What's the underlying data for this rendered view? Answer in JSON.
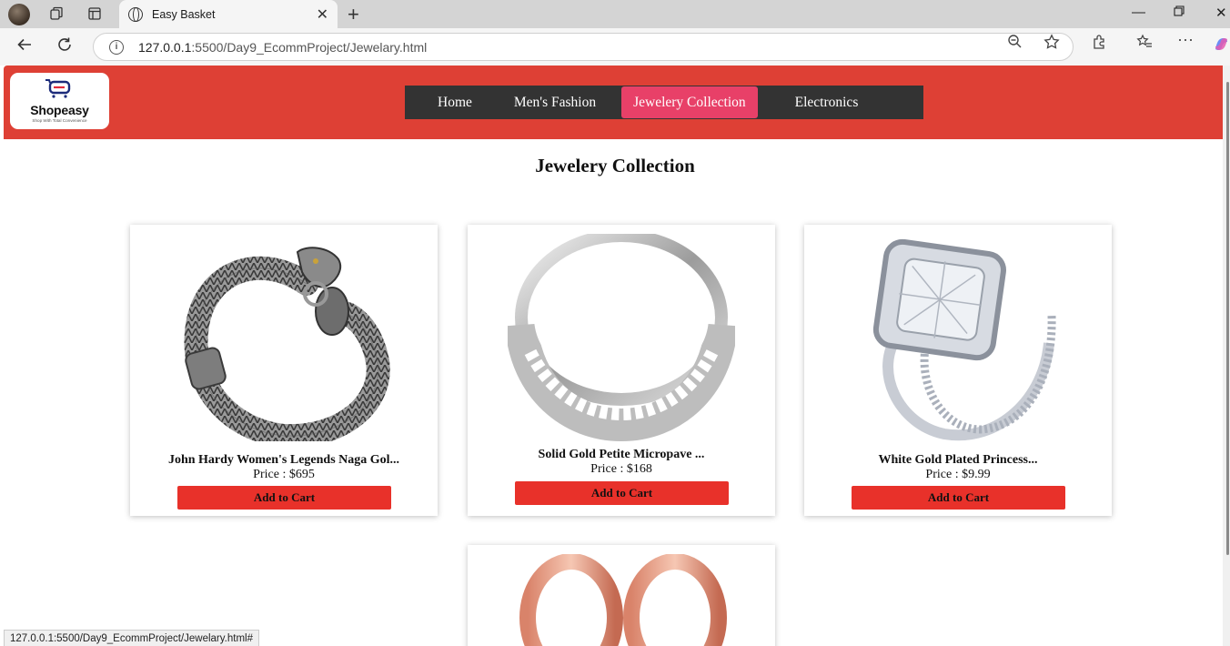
{
  "browser": {
    "tab_title": "Easy Basket",
    "url_host": "127.0.0.1",
    "url_path": ":5500/Day9_EcommProject/Jewelary.html",
    "status_url": "127.0.0.1:5500/Day9_EcommProject/Jewelary.html#"
  },
  "site": {
    "logo_name": "Shopeasy",
    "logo_tagline": "Shop With Total Convenience",
    "nav": [
      {
        "label": "Home",
        "active": false
      },
      {
        "label": "Men's Fashion",
        "active": false
      },
      {
        "label": "Jewelery Collection",
        "active": true
      },
      {
        "label": "Electronics",
        "active": false
      }
    ],
    "page_title": "Jewelery Collection"
  },
  "products": [
    {
      "name": "John Hardy Women's Legends Naga Gol...",
      "price": "Price : $695",
      "button": "Add to Cart",
      "icon": "dragon-bracelet-image"
    },
    {
      "name": "Solid Gold Petite Micropave ...",
      "price": "Price : $168",
      "button": "Add to Cart",
      "icon": "silver-ring-image"
    },
    {
      "name": "White Gold Plated Princess...",
      "price": "Price : $9.99",
      "button": "Add to Cart",
      "icon": "diamond-ring-set-image"
    },
    {
      "name": "",
      "price": "",
      "button": "",
      "icon": "rose-gold-rings-image"
    }
  ],
  "colors": {
    "header_red": "#de4035",
    "nav_dark": "#333333",
    "nav_active": "#e84068",
    "button_red": "#e8312a"
  }
}
